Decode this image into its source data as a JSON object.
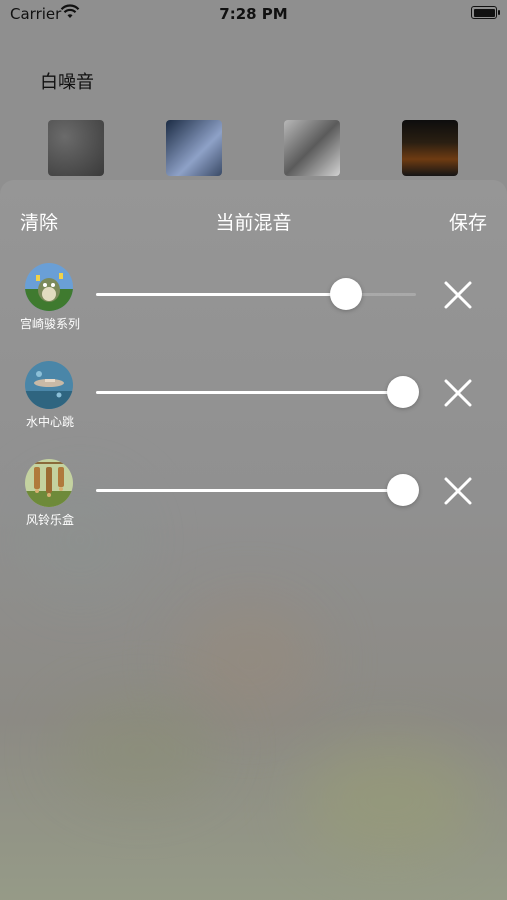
{
  "status_bar": {
    "carrier": "Carrier",
    "time": "7:28 PM"
  },
  "white_noise": {
    "title": "白噪音",
    "thumbnails": [
      "noise-texture",
      "laptop-desk",
      "microscope",
      "oven-fire"
    ]
  },
  "mix_panel": {
    "clear_label": "清除",
    "title": "当前混音",
    "save_label": "保存",
    "tracks": [
      {
        "label": "宫崎骏系列",
        "volume": 0.78
      },
      {
        "label": "水中心跳",
        "volume": 0.96
      },
      {
        "label": "风铃乐盒",
        "volume": 0.96
      }
    ]
  }
}
